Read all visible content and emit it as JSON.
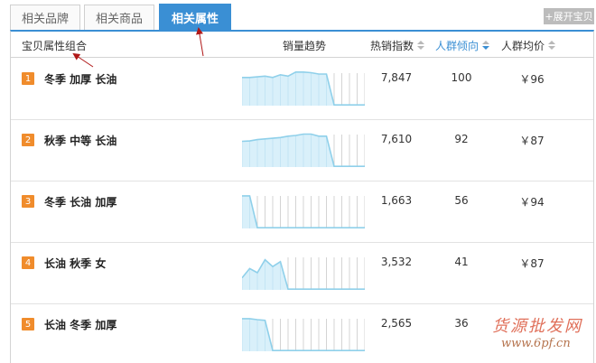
{
  "tabs": [
    {
      "label": "相关品牌",
      "active": false
    },
    {
      "label": "相关商品",
      "active": false
    },
    {
      "label": "相关属性",
      "active": true
    }
  ],
  "expand_button": "+展开宝贝",
  "columns": {
    "combo": "宝贝属性组合",
    "trend": "销量趋势",
    "hot": "热销指数",
    "crowd": "人群倾向",
    "price": "人群均价"
  },
  "rows": [
    {
      "rank": "1",
      "name": "冬季 加厚 长油",
      "hot": "7,847",
      "crowd": "100",
      "price": "￥96",
      "trend": [
        0.82,
        0.82,
        0.84,
        0.86,
        0.82,
        0.9,
        0.86,
        0.98,
        0.98,
        0.96,
        0.92,
        0.92,
        0.02,
        0.02,
        0.02,
        0.02,
        0.02
      ]
    },
    {
      "rank": "2",
      "name": "秋季 中等 长油",
      "hot": "7,610",
      "crowd": "92",
      "price": "￥87",
      "trend": [
        0.75,
        0.76,
        0.8,
        0.82,
        0.84,
        0.86,
        0.9,
        0.92,
        0.96,
        0.96,
        0.9,
        0.9,
        0.02,
        0.02,
        0.02,
        0.02,
        0.02
      ]
    },
    {
      "rank": "3",
      "name": "冬季 长油 加厚",
      "hot": "1,663",
      "crowd": "56",
      "price": "￥94",
      "trend": [
        0.95,
        0.95,
        0.02,
        0.02,
        0.02,
        0.02,
        0.02,
        0.02,
        0.02,
        0.02,
        0.02,
        0.02,
        0.02,
        0.02,
        0.02,
        0.02,
        0.02
      ]
    },
    {
      "rank": "4",
      "name": "长油 秋季 女",
      "hot": "3,532",
      "crowd": "41",
      "price": "￥87",
      "trend": [
        0.35,
        0.62,
        0.5,
        0.88,
        0.68,
        0.82,
        0.02,
        0.02,
        0.02,
        0.02,
        0.02,
        0.02,
        0.02,
        0.02,
        0.02,
        0.02,
        0.02
      ]
    },
    {
      "rank": "5",
      "name": "长油 冬季 加厚",
      "hot": "2,565",
      "crowd": "36",
      "price": "",
      "trend": [
        0.95,
        0.95,
        0.92,
        0.9,
        0.02,
        0.02,
        0.02,
        0.02,
        0.02,
        0.02,
        0.02,
        0.02,
        0.02,
        0.02,
        0.02,
        0.02,
        0.02
      ]
    }
  ],
  "watermark": {
    "title": "货源批发网",
    "url": "www.6pf.cn"
  },
  "colors": {
    "accent": "#3a8fd4",
    "rank": "#f08c2c",
    "spark_line": "#8fd0ea",
    "spark_fill": "#d9f0fa",
    "annotation": "#b01818"
  }
}
